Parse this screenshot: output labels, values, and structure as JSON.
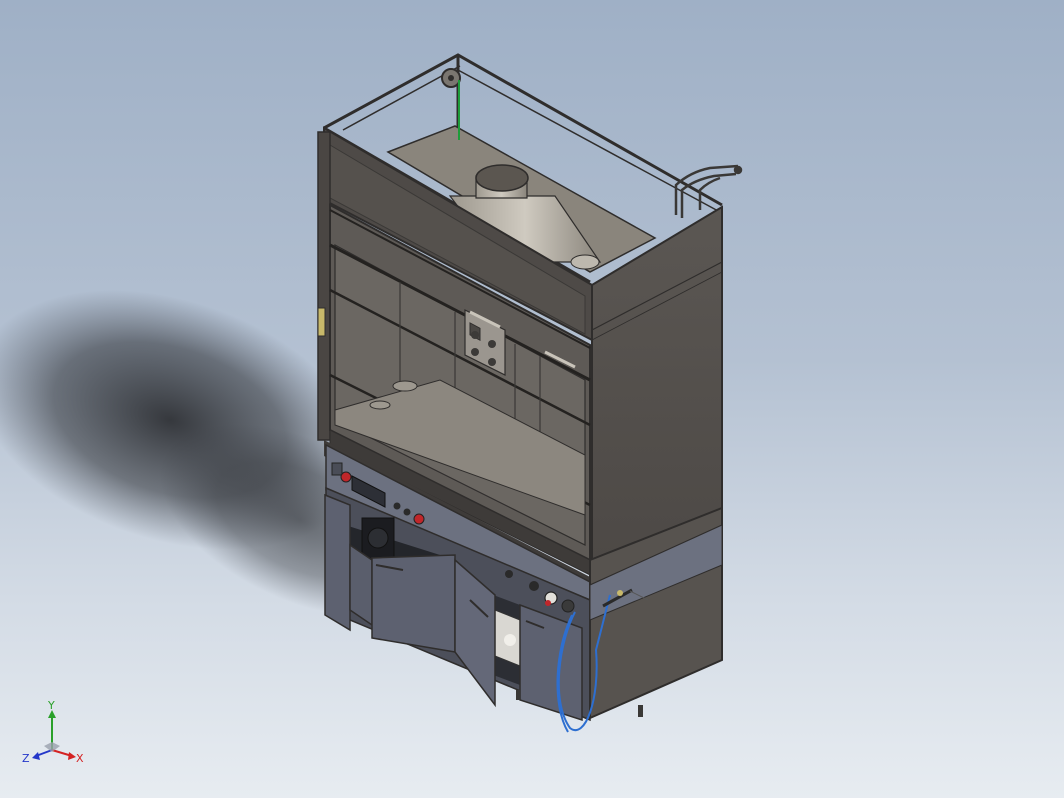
{
  "viewport": {
    "background_top": "#9fb0c6",
    "background_bottom": "#e7ecf1"
  },
  "model": {
    "subject": "fume-hood-cabinet",
    "colors": {
      "body": "#57534f",
      "body_dark": "#3e3b39",
      "frame": "#2f2d2c",
      "glass": "#6f6b67",
      "interior": "#8f8a82",
      "base_panel": "#6c7180",
      "door": "#5d6170",
      "hood_funnel": "#b8b3a9",
      "hose": "#2e6fd0",
      "knob_red": "#c0262a"
    }
  },
  "triad": {
    "x_label": "X",
    "y_label": "Y",
    "z_label": "Z",
    "x_color": "#d42323",
    "y_color": "#2aa02a",
    "z_color": "#2437c9"
  }
}
